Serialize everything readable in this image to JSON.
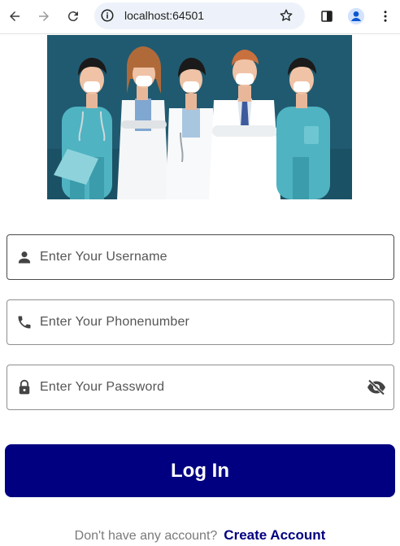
{
  "browser": {
    "url": "localhost:64501"
  },
  "form": {
    "username_placeholder": "Enter Your Username",
    "phone_placeholder": "Enter Your Phonenumber",
    "password_placeholder": "Enter Your Password"
  },
  "login_label": "Log In",
  "footer": {
    "question": "Don't have any account?",
    "create_label": "Create Account"
  },
  "colors": {
    "brand": "#000080",
    "hero_bg": "#205a70",
    "scrub_teal": "#4fb3c2"
  },
  "icons": [
    "back-icon",
    "forward-icon",
    "reload-icon",
    "site-info-icon",
    "bookmark-star-icon",
    "side-panel-icon",
    "profile-icon",
    "menu-icon",
    "person-icon",
    "phone-icon",
    "lock-icon",
    "visibility-off-icon"
  ]
}
